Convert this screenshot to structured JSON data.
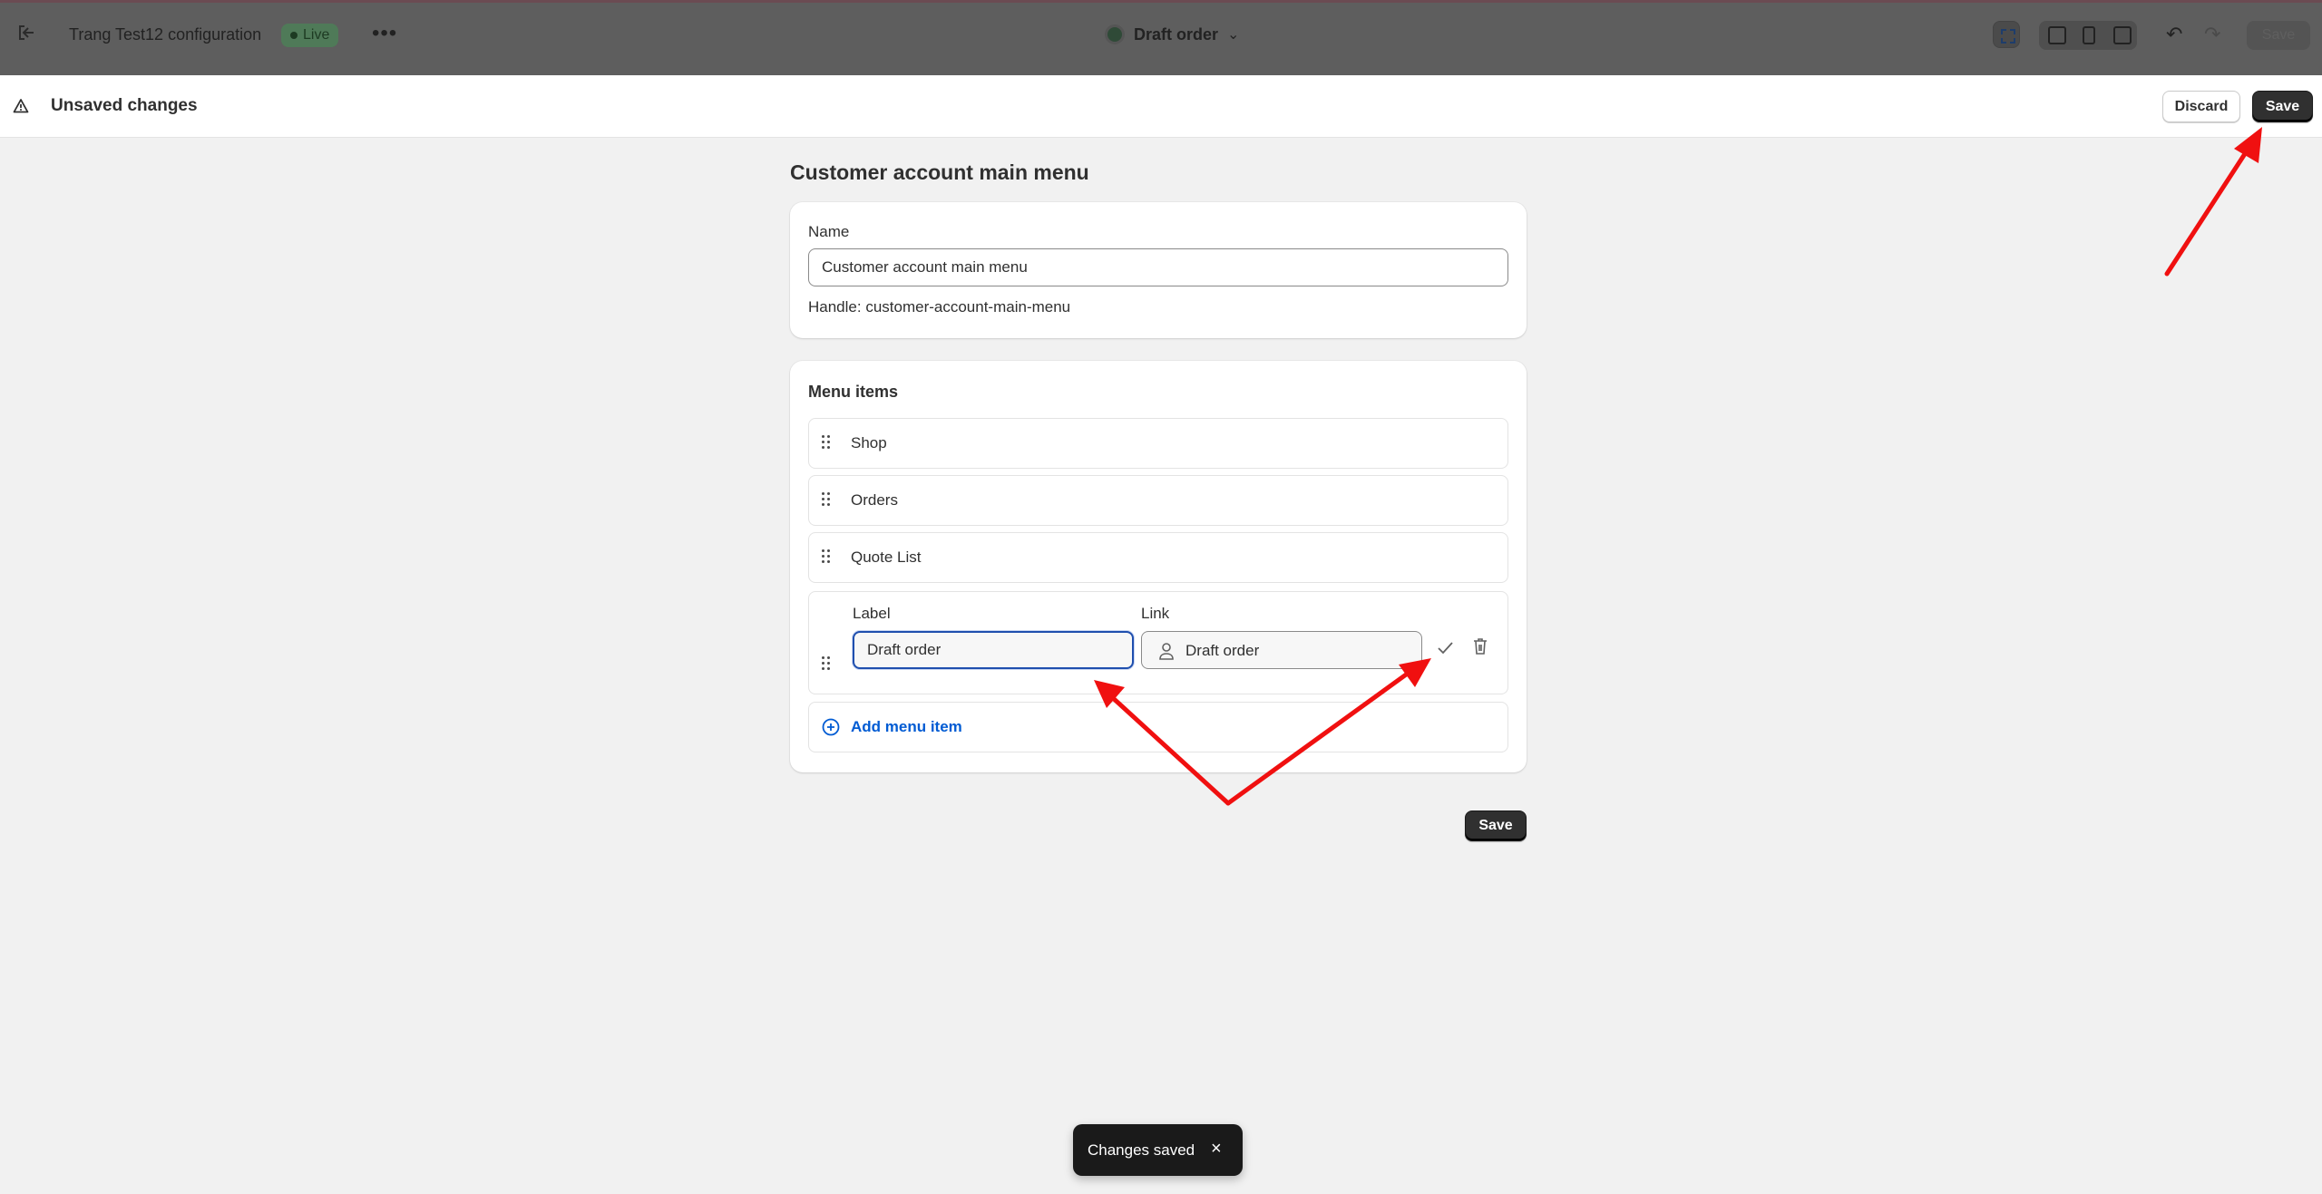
{
  "topbar": {
    "store_title": "Trang Test12 configuration",
    "status_badge": "Live",
    "more_label": "•••",
    "current_page": "Draft order",
    "save_label": "Save"
  },
  "context_bar": {
    "title": "Unsaved changes",
    "discard_label": "Discard",
    "save_label": "Save"
  },
  "page": {
    "title": "Customer account main menu"
  },
  "name_card": {
    "label": "Name",
    "value": "Customer account main menu",
    "handle_text": "Handle: customer-account-main-menu"
  },
  "menu_card": {
    "heading": "Menu items",
    "items": [
      {
        "label": "Shop"
      },
      {
        "label": "Orders"
      },
      {
        "label": "Quote List"
      }
    ],
    "editing_item": {
      "label_caption": "Label",
      "link_caption": "Link",
      "label_value": "Draft order",
      "link_value": "Draft order"
    },
    "add_label": "Add menu item"
  },
  "footer": {
    "save_label": "Save"
  },
  "toast": {
    "message": "Changes saved",
    "close_glyph": "×"
  },
  "colors": {
    "primary_button": "#303030",
    "link_blue": "#005bd3",
    "focus_ring": "#1f4fae",
    "annotation_red": "#f01010",
    "badge_green": "#4f7a58"
  },
  "icons": [
    "exit-icon",
    "chevron-down-icon",
    "inspector-icon",
    "desktop-icon",
    "mobile-icon",
    "fullscreen-icon",
    "undo-icon",
    "redo-icon",
    "warning-icon",
    "drag-handle-icon",
    "person-icon",
    "checkmark-icon",
    "trash-icon",
    "plus-circle-icon",
    "close-icon"
  ]
}
